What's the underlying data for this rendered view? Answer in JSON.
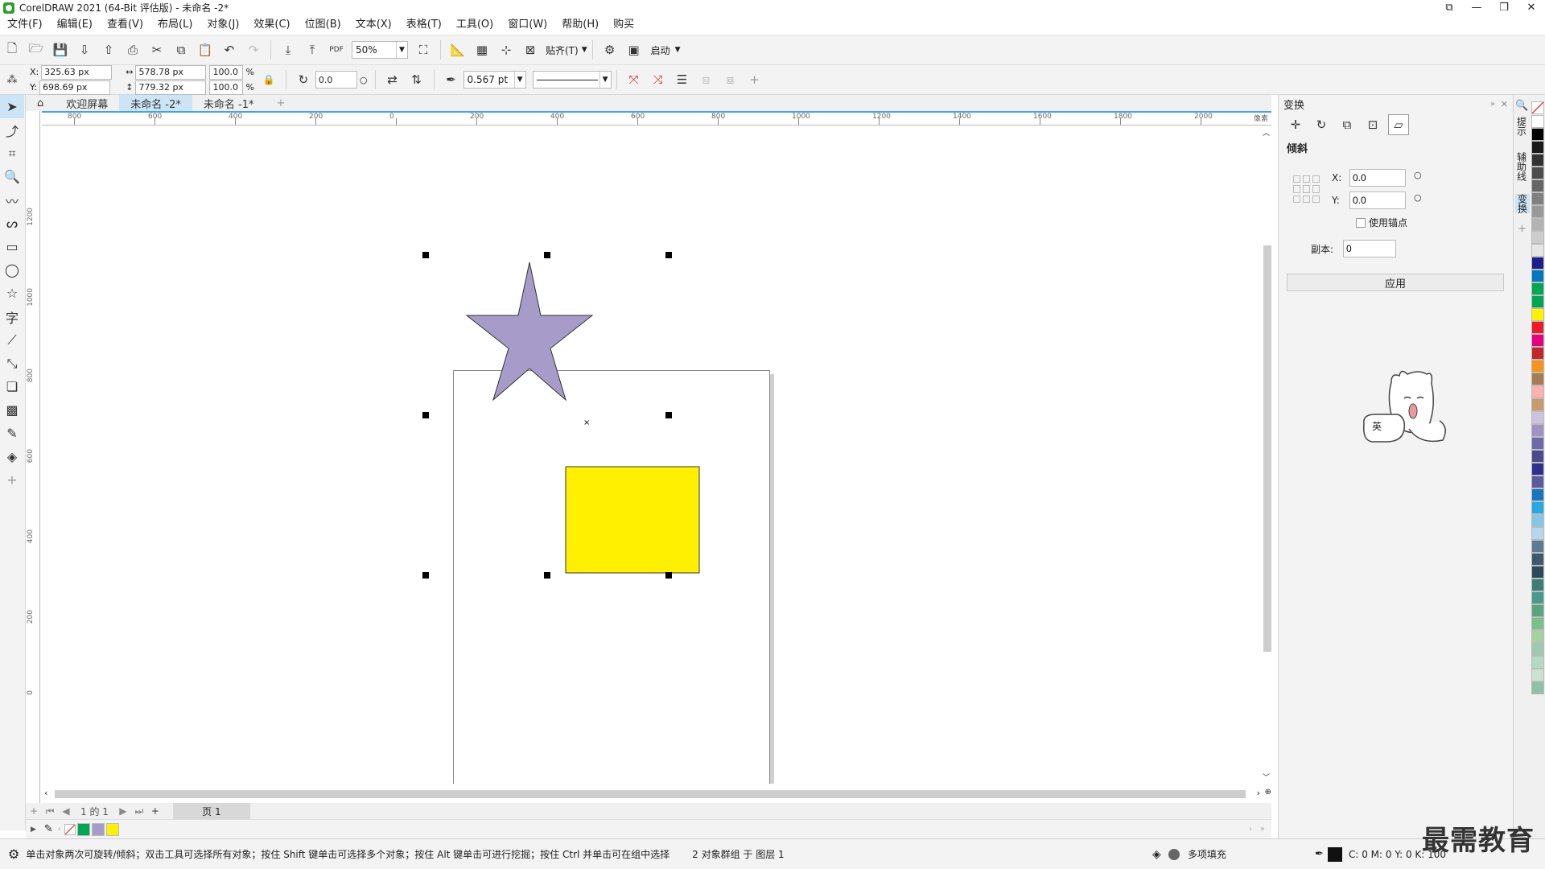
{
  "title": "CorelDRAW 2021 (64-Bit 评估版) - 未命名 -2*",
  "menu": [
    "文件(F)",
    "编辑(E)",
    "查看(V)",
    "布局(L)",
    "对象(J)",
    "效果(C)",
    "位图(B)",
    "文本(X)",
    "表格(T)",
    "工具(O)",
    "窗口(W)",
    "帮助(H)",
    "购买"
  ],
  "toolbar": {
    "zoom": "50%",
    "snap_label": "贴齐(T)",
    "launch_label": "启动",
    "pdf_label": "PDF"
  },
  "propbar": {
    "x_label": "X:",
    "y_label": "Y:",
    "x": "325.63 px",
    "y": "698.69 px",
    "w": "578.78 px",
    "h": "779.32 px",
    "scale_w": "100.0",
    "scale_h": "100.0",
    "pct": "%",
    "angle": "0.0",
    "outline": "0.567 pt"
  },
  "tabs": {
    "welcome": "欢迎屏幕",
    "doc2": "未命名 -2*",
    "doc1": "未命名 -1*"
  },
  "hruler_ticks": [
    "800",
    "600",
    "400",
    "200",
    "0",
    "200",
    "400",
    "600",
    "800",
    "1000",
    "1200",
    "1400",
    "1600",
    "1800",
    "2000"
  ],
  "hruler_unit": "像素",
  "vruler_ticks": [
    "1200",
    "1000",
    "800",
    "600",
    "400",
    "200",
    "0"
  ],
  "pagenav": {
    "page_of": "1 的 1",
    "page_tab": "页 1"
  },
  "docker": {
    "title": "变换",
    "section": "倾斜",
    "x_label": "X:",
    "x_value": "0.0",
    "y_label": "Y:",
    "y_value": "0.0",
    "anchor_label": "使用锚点",
    "copies_label": "副本:",
    "copies_value": "0",
    "apply_label": "应用",
    "ime_badge": "英"
  },
  "docker_tabs": [
    "提示",
    "辅助线",
    "变换"
  ],
  "status": {
    "hint": "单击对象两次可旋转/倾斜；双击工具可选择所有对象；按住 Shift 键单击可选择多个对象；按住 Alt 键单击可进行挖掘；按住 Ctrl 并单击可在组中选择",
    "selection": "2 对象群组 于 图层 1",
    "fill": "多项填充",
    "color": "C: 0 M: 0 Y: 0 K: 100"
  },
  "watermark": "最需教育",
  "colors": {
    "star": "#a79cc9",
    "rect": "#fff000",
    "accent": "#43a3e6"
  },
  "palette": [
    "#ffffff",
    "#000000",
    "#1a1a1a",
    "#333333",
    "#4d4d4d",
    "#666666",
    "#808080",
    "#999999",
    "#b3b3b3",
    "#cccccc",
    "#e6e6e6",
    "#1d1e8c",
    "#0079c1",
    "#00a651",
    "#00a651",
    "#fff200",
    "#ed1c24",
    "#e5007e",
    "#c1272d",
    "#f7941d",
    "#a67c52",
    "#f9b1b1",
    "#c69c6d",
    "#ccc4df",
    "#9e93c4",
    "#6c6aa8",
    "#4a4a8c",
    "#2e3192",
    "#5b5b9e",
    "#1b75bc",
    "#27aae1",
    "#85c6e7",
    "#b3d7ee",
    "#5c7b94",
    "#3b5a6e",
    "#2b4a5a",
    "#3e7d77",
    "#4c9a8d",
    "#5aa67c",
    "#7cc18a",
    "#a2d39c",
    "#9ccbb0",
    "#b6d9c3",
    "#c9e3d0",
    "#8fc1a8"
  ],
  "doc_palette": [
    "#00a651",
    "#a79cc9",
    "#fff200"
  ]
}
